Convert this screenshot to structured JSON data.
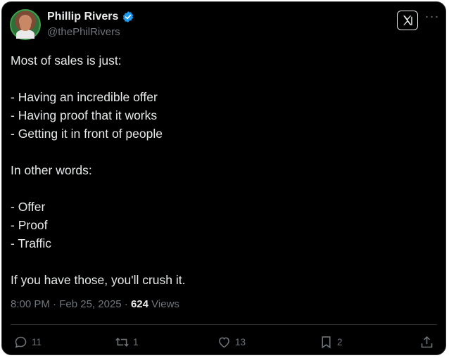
{
  "author": {
    "name": "Phillip Rivers",
    "handle": "@thePhilRivers"
  },
  "tweet": {
    "lines": [
      "Most of sales is just:",
      "",
      "- Having an incredible offer",
      "- Having proof that it works",
      "- Getting it in front of people",
      "",
      "In other words:",
      "",
      "- Offer",
      "- Proof",
      "- Traffic",
      "",
      "If you have those, you'll crush it."
    ],
    "time": "8:00 PM",
    "date": "Feb 25, 2025",
    "views_count": "624",
    "views_label": "Views"
  },
  "actions": {
    "replies": "11",
    "retweets": "1",
    "likes": "13",
    "bookmarks": "2"
  },
  "icons": [
    "verified-badge-icon",
    "x-logo-icon",
    "more-icon",
    "reply-icon",
    "retweet-icon",
    "like-icon",
    "bookmark-icon",
    "share-icon"
  ],
  "colors": {
    "background": "#000000",
    "text": "#e7e9ea",
    "secondary": "#71767b",
    "verified": "#1d9bf0"
  }
}
